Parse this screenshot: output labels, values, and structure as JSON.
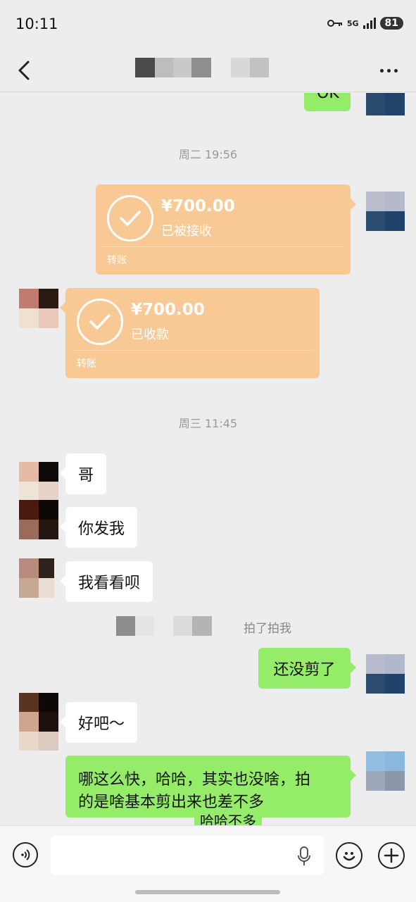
{
  "status_bar": {
    "time": "10:11",
    "network": "5G",
    "battery": "81"
  },
  "messages": {
    "prev_partial_text": "OK",
    "timestamp_1": "周二 19:56",
    "transfer_sent": {
      "amount": "¥700.00",
      "status": "已被接收",
      "label": "转账"
    },
    "transfer_received": {
      "amount": "¥700.00",
      "status": "已收款",
      "label": "转账"
    },
    "timestamp_2": "周三 11:45",
    "msg_1": "哥",
    "msg_2": "你发我",
    "msg_3": "我看看呗",
    "pat_text": "拍了拍我",
    "sent_1": "还没剪了",
    "msg_4": "好吧～",
    "sent_2_line1": "哪这么快，哈哈，其实也没啥，拍",
    "sent_2_line2": "的是啥基本剪出来也差不多",
    "sent_2_partial": "哈哈不多"
  },
  "icons": {
    "back": "chevron-left-icon",
    "more": "more-dots-icon",
    "voice": "voice-icon",
    "mic": "mic-icon",
    "emoji": "emoji-icon",
    "plus": "plus-icon"
  },
  "colors": {
    "background": "#ededed",
    "green_bubble": "#95ec69",
    "transfer": "#f8c994"
  }
}
